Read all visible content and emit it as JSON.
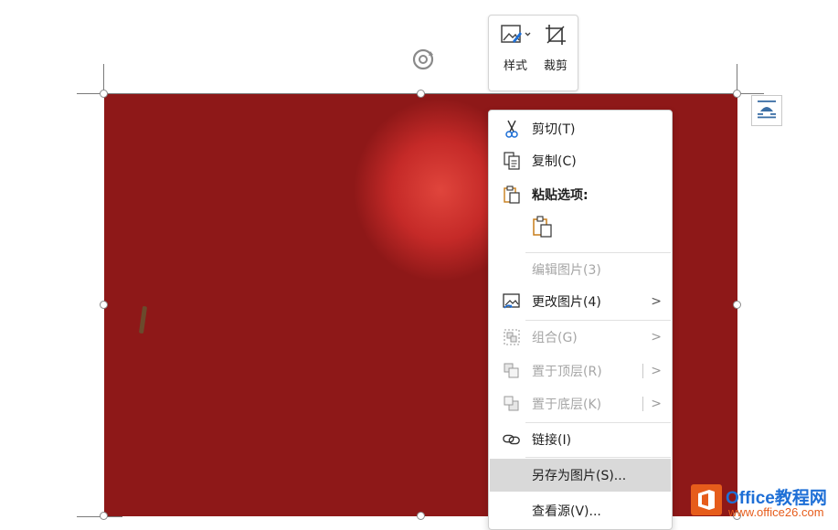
{
  "mini_toolbar": {
    "style_label": "样式",
    "crop_label": "裁剪"
  },
  "context_menu": {
    "cut": "剪切(T)",
    "copy": "复制(C)",
    "paste_options": "粘贴选项:",
    "edit_picture": "编辑图片(3)",
    "change_picture": "更改图片(4)",
    "group": "组合(G)",
    "bring_to_front": "置于顶层(R)",
    "send_to_back": "置于底层(K)",
    "link": "链接(I)",
    "save_as_picture": "另存为图片(S)...",
    "view_source": "查看源(V)..."
  },
  "watermark": {
    "title": "Office教程网",
    "url": "www.office26.com"
  },
  "icons": {
    "rotate": "rotate-handle-icon",
    "style": "picture-style-icon",
    "crop": "crop-icon",
    "layout": "layout-options-icon",
    "cut": "scissors-icon",
    "copy": "copy-icon",
    "paste": "paste-icon",
    "change_picture": "change-picture-icon",
    "group": "group-icon",
    "bring_front": "bring-to-front-icon",
    "send_back": "send-to-back-icon",
    "link": "link-icon"
  },
  "colors": {
    "hover_row": "#d9d9d9",
    "accent_blue": "#1e6fd6",
    "watermark_orange": "#e65c1b"
  }
}
